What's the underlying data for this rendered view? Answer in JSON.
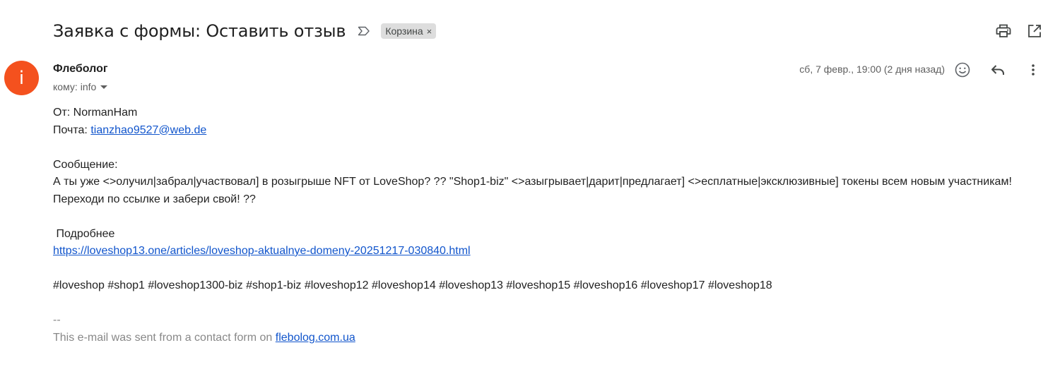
{
  "header": {
    "subject": "Заявка с формы: Оставить отзыв",
    "label": "Корзина",
    "label_close": "×",
    "actions": [
      "print-icon",
      "open-in-new-window-icon"
    ]
  },
  "message": {
    "avatar_letter": "i",
    "sender_name": "Флеболог",
    "recipient_prefix": "кому:",
    "recipient": "info",
    "date": "сб, 7 февр., 19:00 (2 дня назад)",
    "actions": [
      "emoji-reaction-icon",
      "reply-icon",
      "more-options-icon"
    ]
  },
  "body": {
    "from_label": "От:",
    "from_value": "NormanHam",
    "email_label": "Почта:",
    "email_value": "tianzhao9527@web.de",
    "message_label": "Сообщение:",
    "message_line1": "А ты уже <>олучил|забрал|участвовал] в розыгрыше NFT от LoveShop? ?? \"Shop1-biz\" <>азыгрывает|дарит|предлагает] <>есплатные|эксклюзивные] токены всем новым участникам!",
    "message_line2": "Переходи по ссылке и забери свой! ??",
    "more_label": " Подробнее",
    "link": "https://loveshop13.one/articles/loveshop-aktualnye-domeny-20251217-030840.html",
    "hashtags": "#loveshop #shop1 #loveshop1300-biz #shop1-biz #loveshop12 #loveshop14 #loveshop13 #loveshop15 #loveshop16 #loveshop17 #loveshop18",
    "sig_separator": "--",
    "sig_text": "This e-mail was sent from a contact form on ",
    "sig_link": "flebolog.com.ua"
  },
  "colors": {
    "avatar": "#f4511e",
    "link": "#1155cc",
    "label_chip": "#dddddd"
  }
}
